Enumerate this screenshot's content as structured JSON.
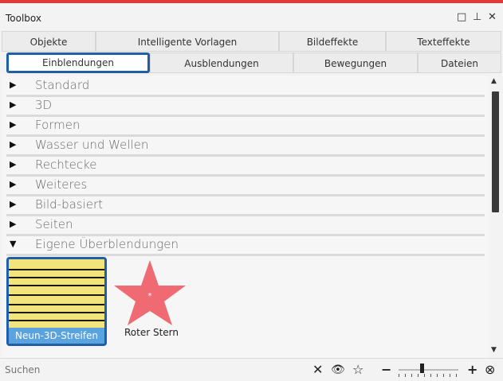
{
  "window": {
    "title": "Toolbox",
    "controls": [
      "□",
      "⊥",
      "✕"
    ]
  },
  "tabs": {
    "row1": [
      "Objekte",
      "Intelligente Vorlagen",
      "Bildeffekte",
      "Texteffekte"
    ],
    "row2": [
      "Einblendungen",
      "Ausblendungen",
      "Bewegungen",
      "Dateien"
    ],
    "active": "Einblendungen"
  },
  "categories": [
    {
      "label": "Standard",
      "expanded": false
    },
    {
      "label": "3D",
      "expanded": false
    },
    {
      "label": "Formen",
      "expanded": false
    },
    {
      "label": "Wasser und Wellen",
      "expanded": false
    },
    {
      "label": "Rechtecke",
      "expanded": false
    },
    {
      "label": "Weiteres",
      "expanded": false
    },
    {
      "label": "Bild-basiert",
      "expanded": false
    },
    {
      "label": "Seiten",
      "expanded": false
    },
    {
      "label": "Eigene Überblendungen",
      "expanded": true
    }
  ],
  "icons": {
    "collapsed": "▶",
    "expanded": "▼",
    "scroll_up": "▲",
    "scroll_down": "▼",
    "clear": "✕",
    "eye": "👁",
    "star": "☆",
    "minus": "−",
    "plus": "+",
    "reset": "⊗"
  },
  "items": [
    {
      "label": "Neun-3D-Streifen",
      "selected": true
    },
    {
      "label": "Roter Stern",
      "selected": false
    }
  ],
  "search": {
    "placeholder": "Suchen"
  },
  "zoom": {
    "level": 0.38
  },
  "colors": {
    "accent_line": "#e2393d",
    "selection_border": "#1f5ea8",
    "selection_caption": "#5aa3e0",
    "star": "#f06a74"
  }
}
